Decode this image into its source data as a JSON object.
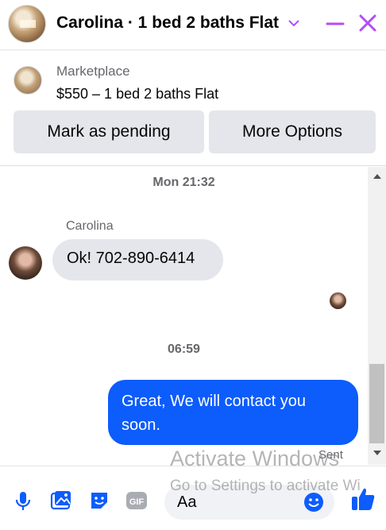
{
  "header": {
    "title": "Carolina · 1 bed 2 baths Flat",
    "accent_color": "#b44cf5"
  },
  "marketplace": {
    "label": "Marketplace",
    "listing": "$550 – 1 bed 2 baths Flat",
    "buttons": {
      "pending": "Mark as pending",
      "more": "More Options"
    }
  },
  "messages": {
    "timestamps": [
      "Mon 21:32",
      "06:59"
    ],
    "sender_name": "Carolina",
    "incoming": "Ok! 702-890-6414",
    "outgoing": "Great, We will contact you soon.",
    "status": "Sent",
    "outgoing_color": "#0d5cfc"
  },
  "composer": {
    "placeholder": "Aa",
    "icons": [
      "microphone-icon",
      "photo-icon",
      "sticker-icon",
      "gif-icon",
      "emoji-icon",
      "thumbs-up-icon"
    ]
  },
  "watermark": {
    "line1": "Activate Windows",
    "line2": "Go to Settings to activate Wi"
  }
}
